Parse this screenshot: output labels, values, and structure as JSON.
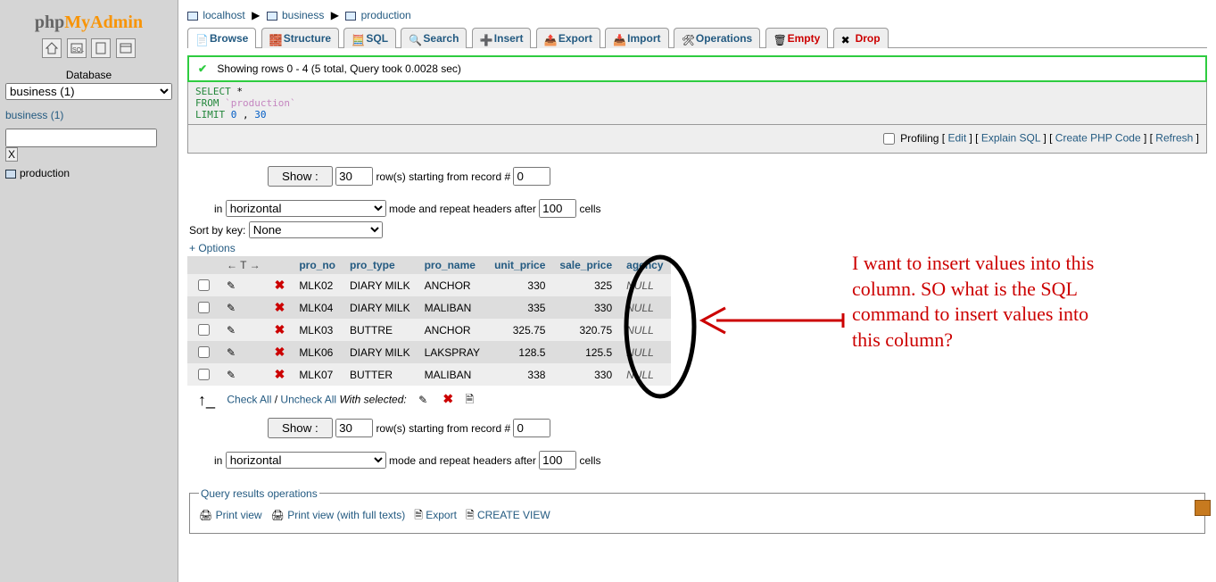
{
  "breadcrumb": {
    "server": "localhost",
    "database": "business",
    "table": "production"
  },
  "tabs": [
    {
      "label": "Browse"
    },
    {
      "label": "Structure"
    },
    {
      "label": "SQL"
    },
    {
      "label": "Search"
    },
    {
      "label": "Insert"
    },
    {
      "label": "Export"
    },
    {
      "label": "Import"
    },
    {
      "label": "Operations"
    },
    {
      "label": "Empty"
    },
    {
      "label": "Drop"
    }
  ],
  "success_msg": "Showing rows 0 - 4 (5 total, Query took 0.0028 sec)",
  "query": {
    "line1_a": "SELECT",
    "line1_b": " *",
    "line2_a": "FROM ",
    "line2_b": "`production`",
    "line3_a": "LIMIT ",
    "line3_b": "0",
    "line3_c": " , ",
    "line3_d": "30"
  },
  "querylinks": {
    "profiling": "Profiling",
    "edit": "Edit",
    "explain": "Explain SQL",
    "php": "Create PHP Code",
    "refresh": "Refresh"
  },
  "nav": {
    "show_btn": "Show :",
    "show_n": "30",
    "rows_from": "row(s) starting from record #",
    "start": "0",
    "in": "in",
    "mode_after": "mode and repeat headers after",
    "headers": "100",
    "cells": "cells",
    "mode_options": [
      "horizontal"
    ],
    "mode_selected": "horizontal"
  },
  "sort": {
    "label": "Sort by key:",
    "selected": "None"
  },
  "options": "+ Options",
  "columns": [
    "pro_no",
    "pro_type",
    "pro_name",
    "unit_price",
    "sale_price",
    "agency"
  ],
  "rows": [
    {
      "pro_no": "MLK02",
      "pro_type": "DIARY MILK",
      "pro_name": "ANCHOR",
      "unit_price": "330",
      "sale_price": "325",
      "agency": "NULL"
    },
    {
      "pro_no": "MLK04",
      "pro_type": "DIARY MILK",
      "pro_name": "MALIBAN",
      "unit_price": "335",
      "sale_price": "330",
      "agency": "NULL"
    },
    {
      "pro_no": "MLK03",
      "pro_type": "BUTTRE",
      "pro_name": "ANCHOR",
      "unit_price": "325.75",
      "sale_price": "320.75",
      "agency": "NULL"
    },
    {
      "pro_no": "MLK06",
      "pro_type": "DIARY MILK",
      "pro_name": "LAKSPRAY",
      "unit_price": "128.5",
      "sale_price": "125.5",
      "agency": "NULL"
    },
    {
      "pro_no": "MLK07",
      "pro_type": "BUTTER",
      "pro_name": "MALIBAN",
      "unit_price": "338",
      "sale_price": "330",
      "agency": "NULL"
    }
  ],
  "withsel": {
    "check_all": "Check All",
    "uncheck_all": "Uncheck All",
    "with": "With selected:"
  },
  "qops": {
    "legend": "Query results operations",
    "print": "Print view",
    "printfull": "Print view (with full texts)",
    "export": "Export",
    "createview": "CREATE VIEW"
  },
  "left": {
    "db_label": "Database",
    "db_options": [
      "business (1)"
    ],
    "db_selected": "business (1)",
    "tree_db": "business (1)",
    "filter_x": "X",
    "table": "production"
  },
  "annotation": "I want to insert values into this column. SO what is the SQL command to insert values into this column?"
}
